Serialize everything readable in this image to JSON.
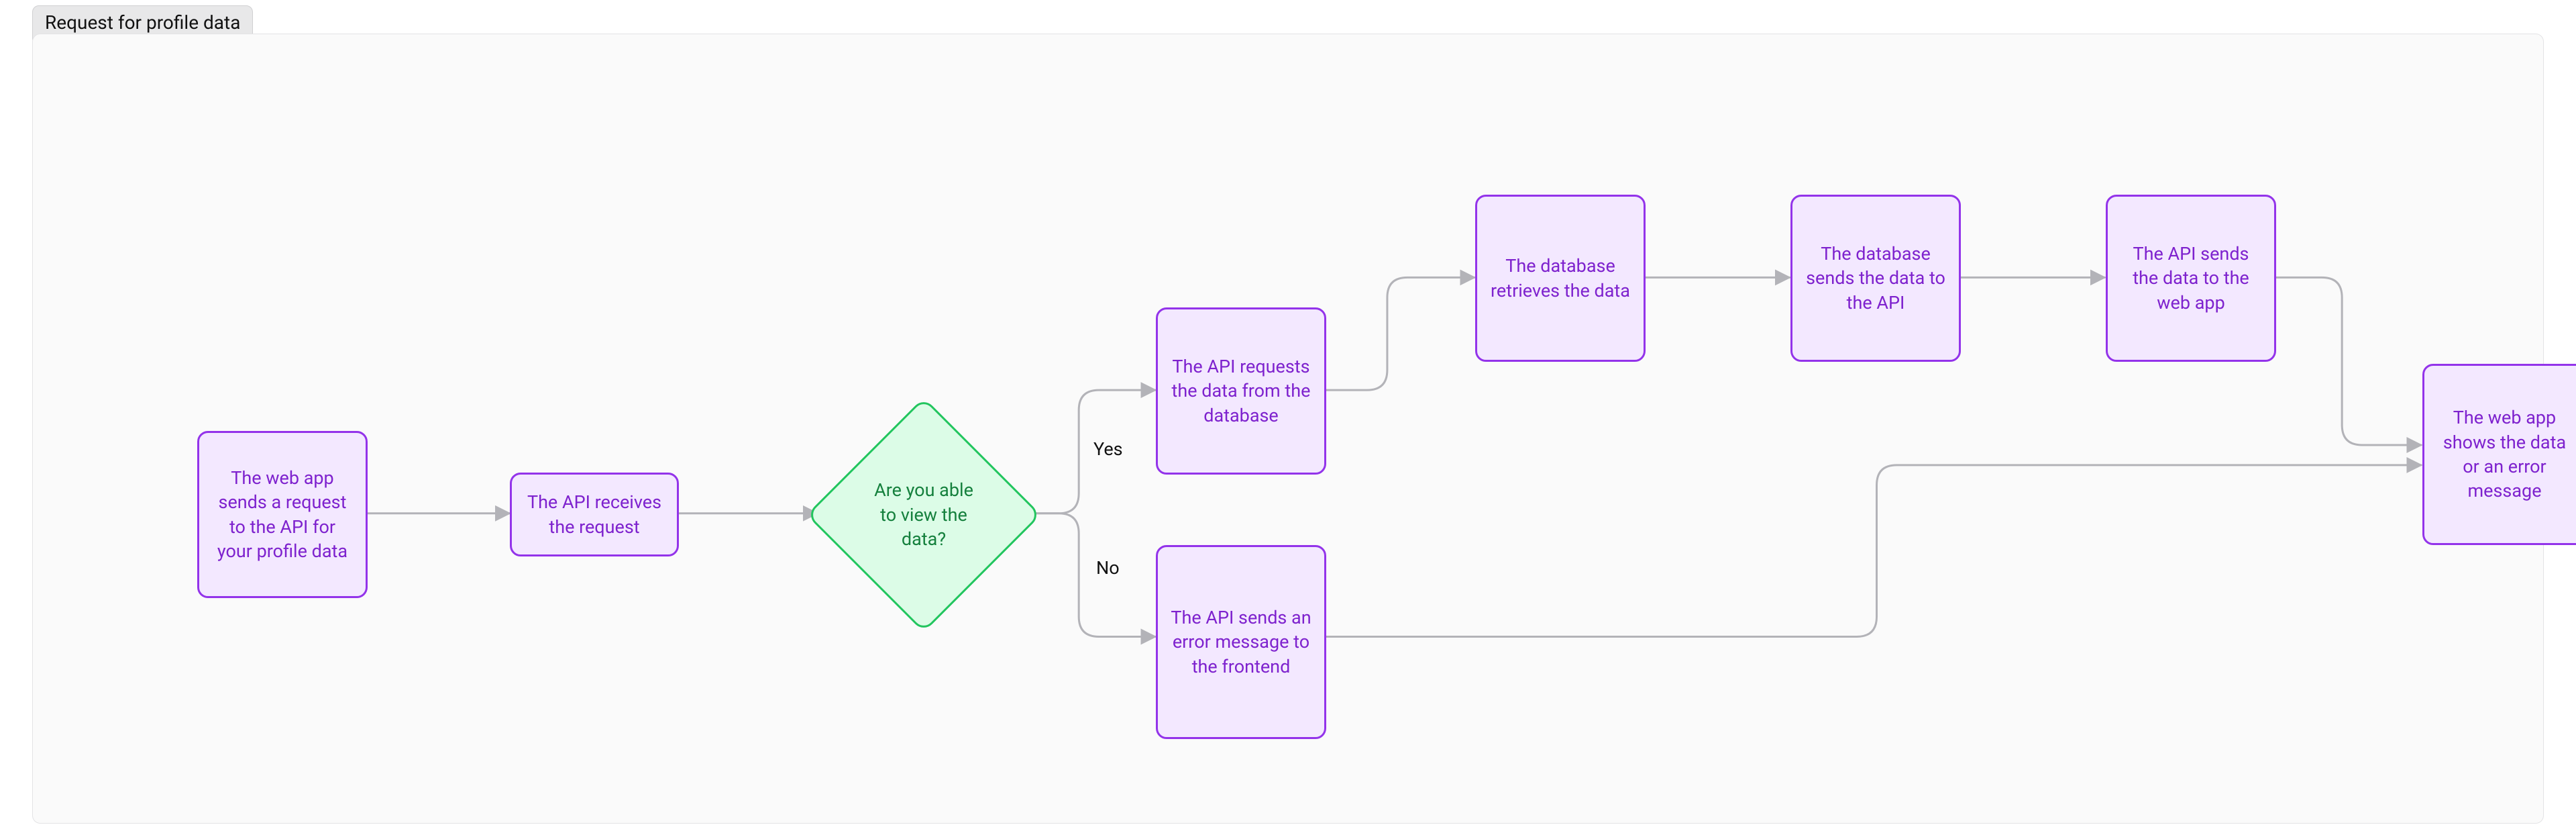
{
  "tab": {
    "title": "Request for profile data"
  },
  "nodes": {
    "n1": "The web app sends a request to the API for your profile data",
    "n2": "The API receives the request",
    "n3": "Are you able to view the data?",
    "n4": "The API requests the data from the database",
    "n5": "The database retrieves the data",
    "n6": "The database sends the data to the API",
    "n7": "The API sends the data to the web app",
    "n8": "The API sends an error message to the frontend",
    "n9": "The web app shows the data or an error message"
  },
  "edges": {
    "yes": "Yes",
    "no": "No"
  },
  "colors": {
    "process_fill": "#f3e8ff",
    "process_border": "#9333ea",
    "process_text": "#7e22ce",
    "decision_fill": "#dcfce7",
    "decision_border": "#22c55e",
    "decision_text": "#15803d",
    "panel_bg": "#fafafa",
    "panel_border": "#e3e3e5",
    "edge": "#b3b3b8"
  },
  "diagram": {
    "type": "flowchart",
    "title": "Request for profile data",
    "nodes": [
      {
        "id": "n1",
        "kind": "process",
        "text": "The web app sends a request to the API for your profile data"
      },
      {
        "id": "n2",
        "kind": "process",
        "text": "The API receives the request"
      },
      {
        "id": "n3",
        "kind": "decision",
        "text": "Are you able to view the data?"
      },
      {
        "id": "n4",
        "kind": "process",
        "text": "The API requests the data from the database"
      },
      {
        "id": "n5",
        "kind": "process",
        "text": "The database retrieves the data"
      },
      {
        "id": "n6",
        "kind": "process",
        "text": "The database sends the data to the API"
      },
      {
        "id": "n7",
        "kind": "process",
        "text": "The API sends the data to the web app"
      },
      {
        "id": "n8",
        "kind": "process",
        "text": "The API sends an error message to the frontend"
      },
      {
        "id": "n9",
        "kind": "process",
        "text": "The web app shows the data or an error message"
      }
    ],
    "edges": [
      {
        "from": "n1",
        "to": "n2"
      },
      {
        "from": "n2",
        "to": "n3"
      },
      {
        "from": "n3",
        "to": "n4",
        "label": "Yes"
      },
      {
        "from": "n3",
        "to": "n8",
        "label": "No"
      },
      {
        "from": "n4",
        "to": "n5"
      },
      {
        "from": "n5",
        "to": "n6"
      },
      {
        "from": "n6",
        "to": "n7"
      },
      {
        "from": "n7",
        "to": "n9"
      },
      {
        "from": "n8",
        "to": "n9"
      }
    ]
  }
}
